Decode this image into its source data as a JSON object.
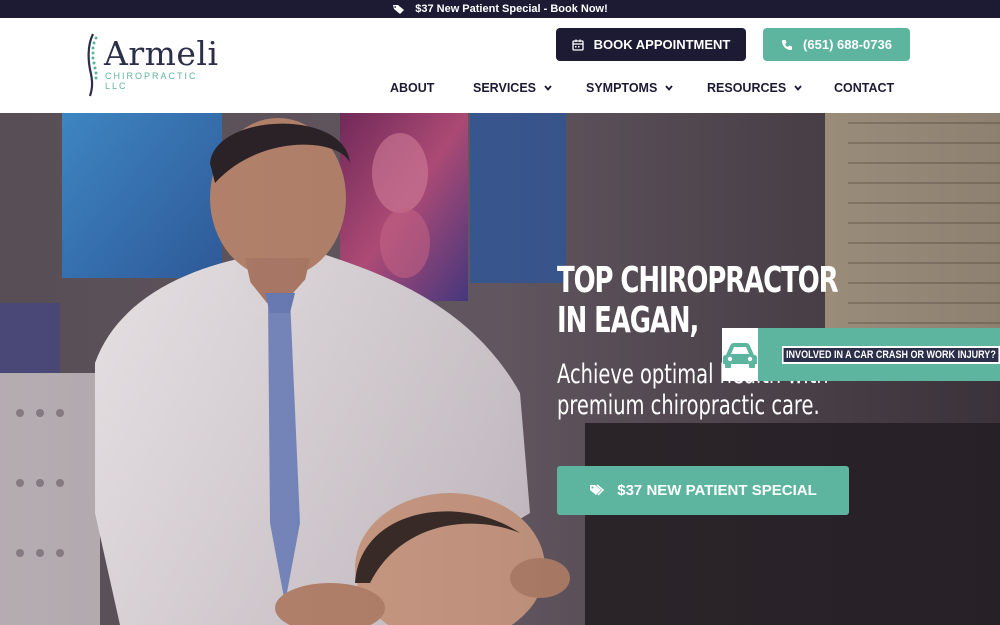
{
  "topbar": {
    "icon": "tag-icon",
    "text": "$37 New Patient Special - Book Now!"
  },
  "logo": {
    "name": "Armeli",
    "subtitle": "CHIROPRACTIC LLC"
  },
  "header": {
    "book_label": "BOOK APPOINTMENT",
    "book_icon": "calendar-icon",
    "phone_label": "(651) 688-0736",
    "phone_icon": "phone-icon"
  },
  "nav": {
    "items": [
      {
        "label": "ABOUT",
        "has_dropdown": false
      },
      {
        "label": "SERVICES",
        "has_dropdown": true
      },
      {
        "label": "SYMPTOMS",
        "has_dropdown": true
      },
      {
        "label": "RESOURCES",
        "has_dropdown": true
      },
      {
        "label": "CONTACT",
        "has_dropdown": false
      }
    ]
  },
  "hero": {
    "title": "TOP CHIROPRACTOR IN EAGAN,",
    "subtitle": "Achieve optimal health with premium chiropractic care.",
    "cta_label": "$37 NEW PATIENT SPECIAL",
    "cta_icon": "tags-icon"
  },
  "crash_widget": {
    "icon": "car-icon",
    "label": "INVOLVED IN A CAR CRASH OR WORK INJURY?"
  },
  "colors": {
    "navy": "#1d1a33",
    "teal": "#5db5a0",
    "white": "#ffffff"
  }
}
